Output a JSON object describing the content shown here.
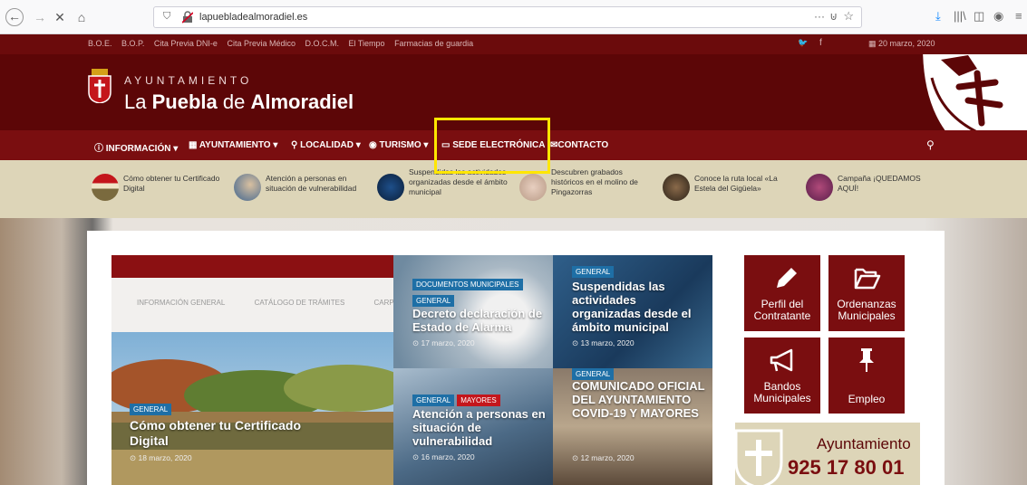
{
  "browser": {
    "url": "lapuebladealmoradiel.es",
    "back_glyph": "←",
    "forward_glyph": "→",
    "stop_glyph": "✕",
    "home_glyph": "⌂",
    "dots_glyph": "···",
    "pocket_glyph": "⊍",
    "star_glyph": "☆",
    "download_glyph": "⤓",
    "library_glyph": "|||\\",
    "sidebar_glyph": "◫",
    "account_glyph": "◉",
    "menu_glyph": "≡"
  },
  "topbar": {
    "links": [
      "B.O.E.",
      "B.O.P.",
      "Cita Previa DNI-e",
      "Cita Previa Médico",
      "D.O.C.M.",
      "El Tiempo",
      "Farmacias de guardia"
    ],
    "twitter_glyph": "🐦",
    "facebook_glyph": "f",
    "date": "20 marzo, 2020"
  },
  "header": {
    "logo_top": "AYUNTAMIENTO",
    "logo_la": "La ",
    "logo_puebla": "Puebla",
    "logo_de": " de ",
    "logo_almoradiel": "Almoradiel"
  },
  "nav": {
    "items": [
      {
        "label": "INFORMACIÓN ▾",
        "icon": "ⓘ"
      },
      {
        "label": "AYUNTAMIENTO ▾",
        "icon": "▦"
      },
      {
        "label": "LOCALIDAD ▾",
        "icon": "⚲"
      },
      {
        "label": "TURISMO ▾",
        "icon": "◉"
      },
      {
        "label": "SEDE ELECTRÓNICA",
        "icon": "▭"
      },
      {
        "label": "CONTACTO",
        "icon": "✉"
      }
    ],
    "search_glyph": "⚲"
  },
  "ticker": [
    {
      "text": "Cómo obtener tu Certificado Digital"
    },
    {
      "text": "Atención a personas en situación de vulnerabilidad"
    },
    {
      "text": "Suspendidas las actividades organizadas desde el ámbito municipal"
    },
    {
      "text": "Descubren grabados históricos en el molino de Pingazorras"
    },
    {
      "text": "Conoce la ruta local «La Estela del Gigüela»"
    },
    {
      "text": "Campaña ¡QUEDAMOS AQUÍ!"
    }
  ],
  "featured": {
    "web_menu": [
      "INFORMACIÓN GENERAL",
      "CATÁLOGO DE TRÁMITES",
      "CARPETA"
    ],
    "badge": "GENERAL",
    "title": "Cómo obtener tu Certificado Digital",
    "date": "⊙ 18 marzo, 2020"
  },
  "tiles": [
    {
      "badges": [
        "DOCUMENTOS MUNICIPALES",
        "GENERAL"
      ],
      "title": "Decreto declaración de Estado de Alarma",
      "date": "⊙ 17 marzo, 2020"
    },
    {
      "badges": [
        "GENERAL"
      ],
      "title": "Suspendidas las actividades organizadas desde el ámbito municipal",
      "date": "⊙ 13 marzo, 2020"
    },
    {
      "badges": [
        "GENERAL",
        "MAYORES"
      ],
      "title": "Atención a personas en situación de vulnerabilidad",
      "date": "⊙ 16 marzo, 2020"
    },
    {
      "badges": [
        "GENERAL"
      ],
      "title": "COMUNICADO OFICIAL DEL AYUNTAMIENTO COVID-19 Y MAYORES",
      "date": "⊙ 12 marzo, 2020"
    }
  ],
  "quick_links": [
    {
      "line1": "Perfil del",
      "line2": "Contratante"
    },
    {
      "line1": "Ordenanzas",
      "line2": "Municipales"
    },
    {
      "line1": "Bandos",
      "line2": "Municipales"
    },
    {
      "line1": "Empleo",
      "line2": ""
    }
  ],
  "phone": {
    "label": "Ayuntamiento",
    "number": "925 17 80 01"
  },
  "colors": {
    "brand_dark": "#5c0607",
    "brand": "#7a0e10",
    "ticker_bg": "#ddd5b8",
    "badge_blue": "#1e6fa6",
    "badge_red": "#c4161c",
    "highlight": "#ffe600"
  }
}
